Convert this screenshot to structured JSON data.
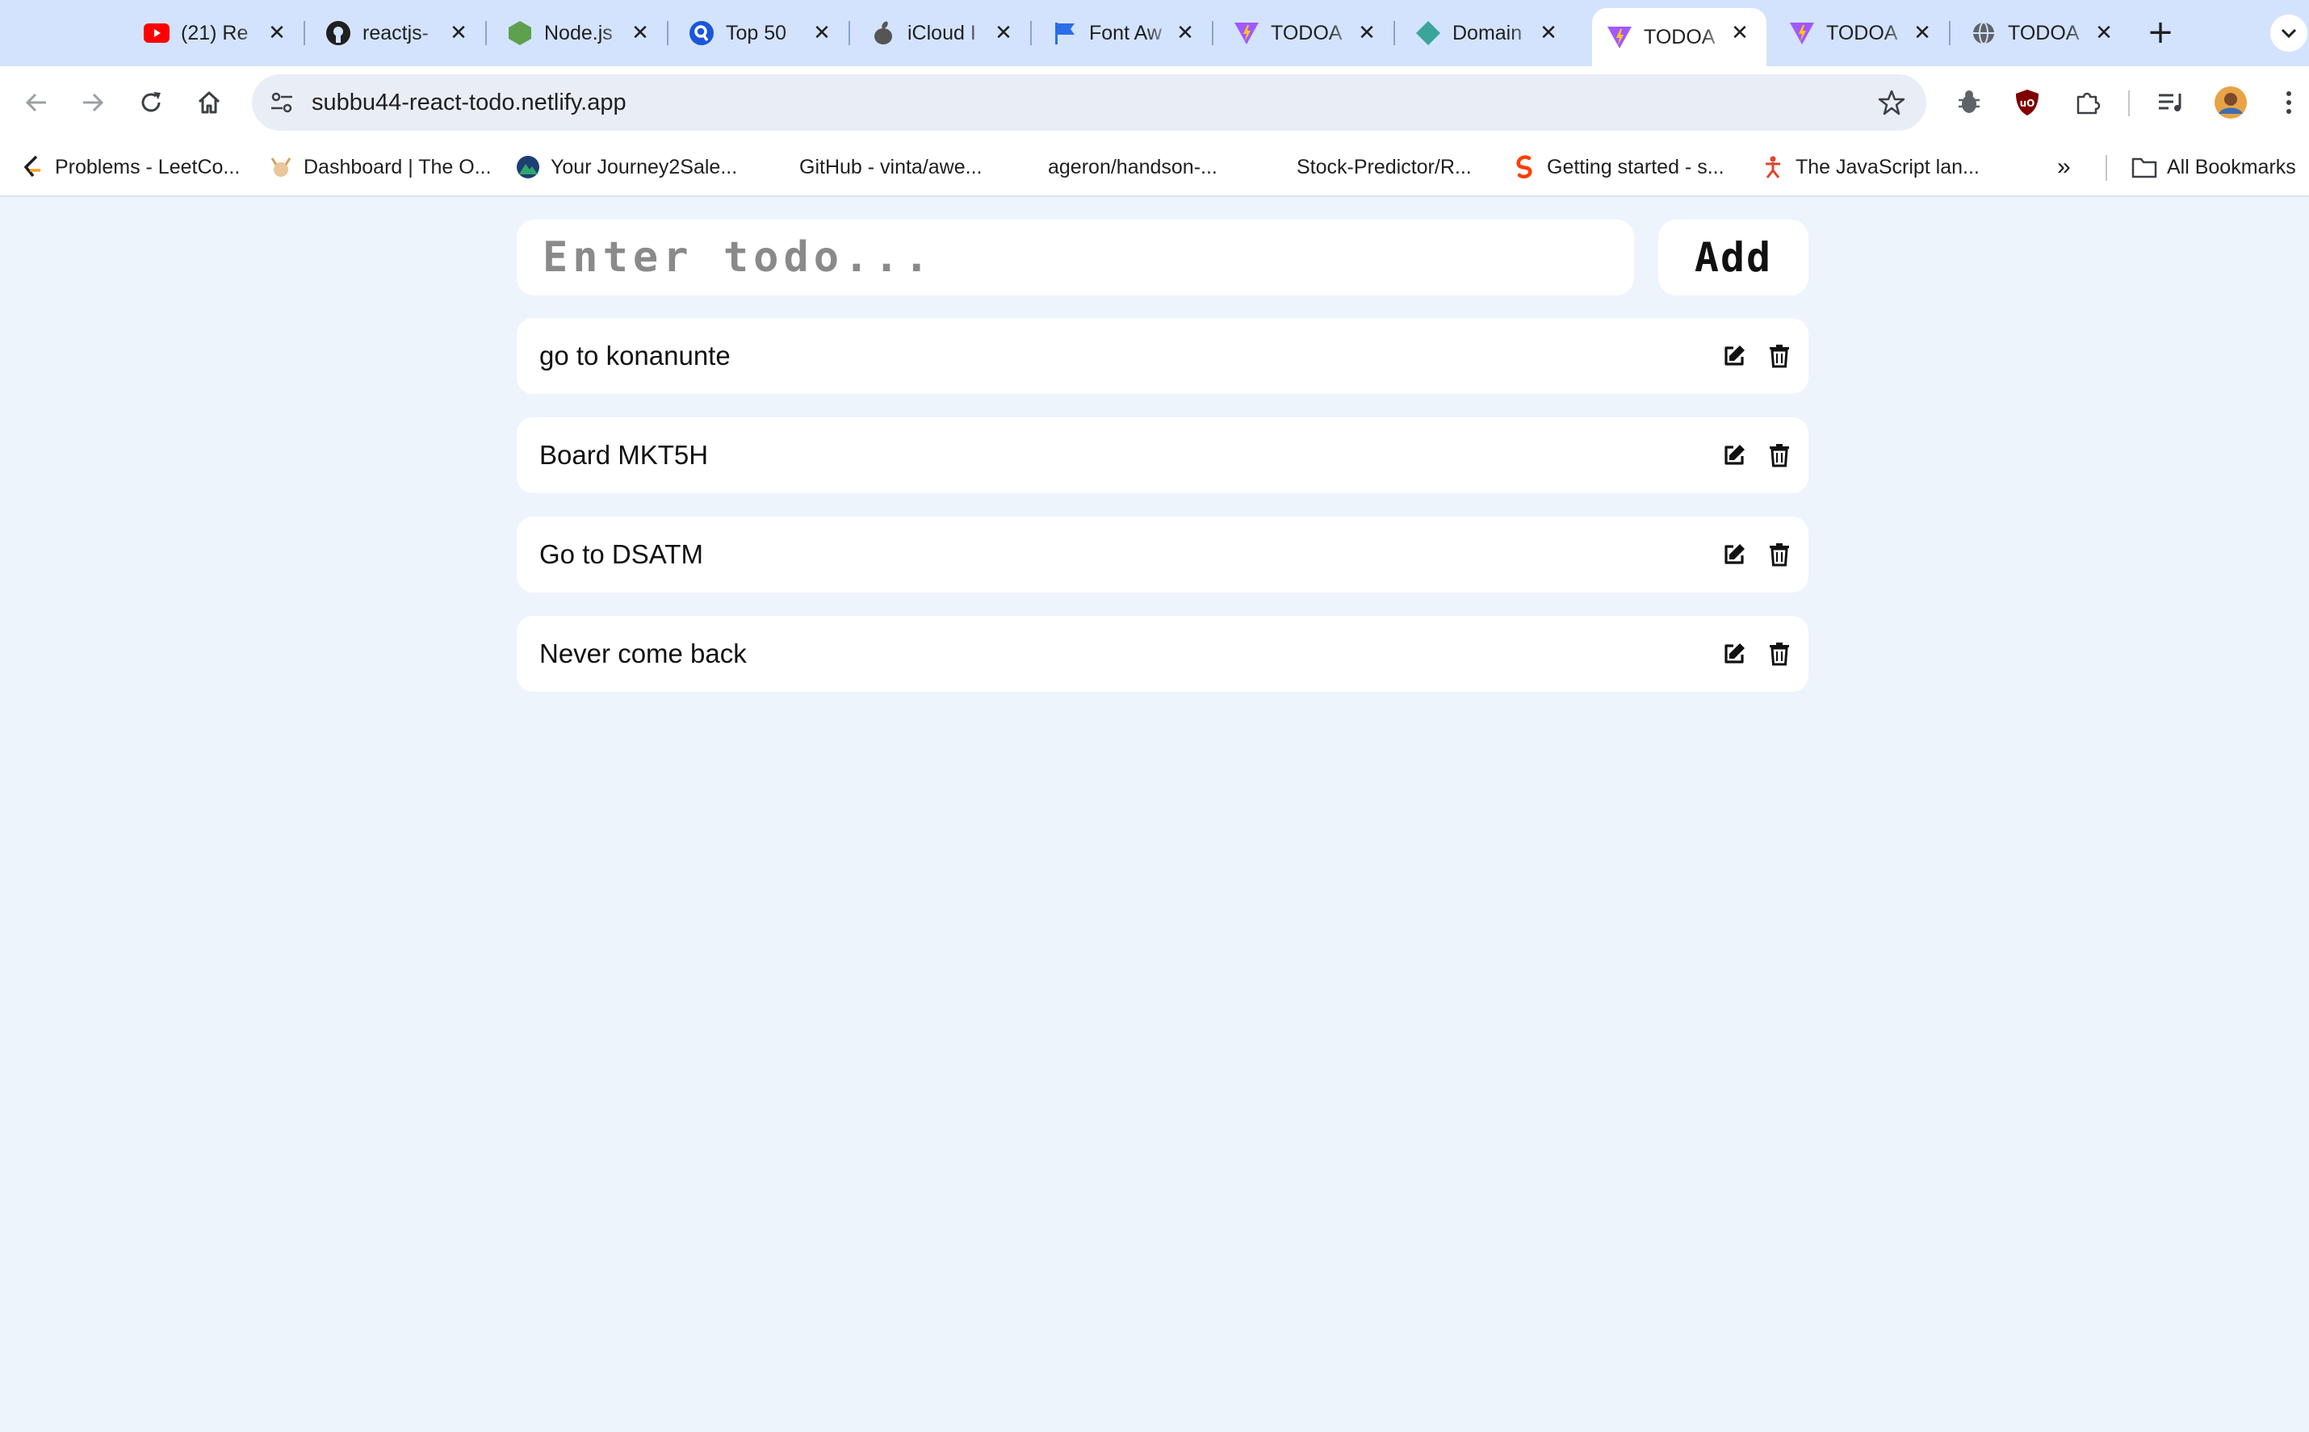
{
  "browser": {
    "tabs": [
      {
        "title": "(21) Re",
        "icon": "youtube-icon",
        "active": false
      },
      {
        "title": "reactjs-",
        "icon": "github-icon",
        "active": false
      },
      {
        "title": "Node.js",
        "icon": "nodejs-icon",
        "active": false
      },
      {
        "title": "Top 50",
        "icon": "search-q-icon",
        "active": false
      },
      {
        "title": "iCloud I",
        "icon": "apple-icon",
        "active": false
      },
      {
        "title": "Font Aw",
        "icon": "flag-icon",
        "active": false
      },
      {
        "title": "TODOA",
        "icon": "vite-icon",
        "active": false
      },
      {
        "title": "Domain",
        "icon": "diamond-icon",
        "active": false
      },
      {
        "title": "TODOA",
        "icon": "vite-icon",
        "active": true
      },
      {
        "title": "TODOA",
        "icon": "vite-icon",
        "active": false
      },
      {
        "title": "TODOA",
        "icon": "globe-icon",
        "active": false
      }
    ],
    "url": "subbu44-react-todo.netlify.app",
    "bookmarks": [
      {
        "label": "Problems - LeetCo...",
        "icon": "leetcode-icon"
      },
      {
        "label": "Dashboard | The O...",
        "icon": "viking-icon"
      },
      {
        "label": "Your Journey2Sale...",
        "icon": "mountain-icon"
      },
      {
        "label": "GitHub - vinta/awe...",
        "icon": ""
      },
      {
        "label": "ageron/handson-...",
        "icon": ""
      },
      {
        "label": "Stock-Predictor/R...",
        "icon": ""
      },
      {
        "label": "Getting started - s...",
        "icon": "svelte-icon"
      },
      {
        "label": "The JavaScript lan...",
        "icon": "figure-icon"
      }
    ],
    "bookmarks_overflow": "»",
    "all_bookmarks": "All Bookmarks"
  },
  "app": {
    "input_placeholder": "Enter todo...",
    "input_value": "",
    "add_label": "Add",
    "todos": [
      {
        "text": "go to konanunte"
      },
      {
        "text": "Board MKT5H"
      },
      {
        "text": "Go to DSATM"
      },
      {
        "text": "Never come back"
      }
    ]
  },
  "colors": {
    "page_background": "#eef4fc",
    "tabstrip": "#d3e3fd",
    "card": "#ffffff"
  }
}
